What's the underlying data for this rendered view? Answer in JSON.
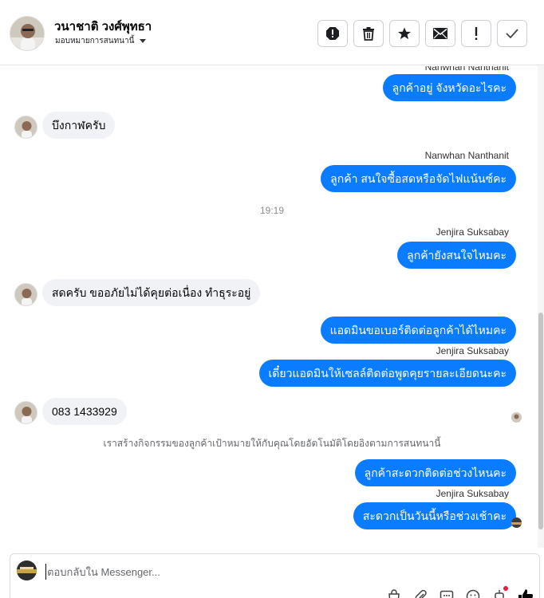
{
  "header": {
    "contact_name": "วนาชาติ วงศ์พุทธา",
    "assign_label": "มอบหมายการสนทนานี้",
    "actions": [
      {
        "name": "spam-alert-icon",
        "label": ""
      },
      {
        "name": "trash-icon",
        "label": ""
      },
      {
        "name": "star-icon",
        "label": ""
      },
      {
        "name": "mail-icon",
        "label": ""
      },
      {
        "name": "exclamation-icon",
        "label": ""
      },
      {
        "name": "check-icon",
        "label": ""
      }
    ]
  },
  "messages": {
    "clipped_sender": "Nanwhan Nanthanit",
    "m1": "ลูกค้าอยู่ จังหวัดอะไรคะ",
    "m2": "บึงกาฬครับ",
    "s3": "Nanwhan Nanthanit",
    "m3": "ลูกค้า สนใจซื้อสดหรือจัดไฟแน้นซ์คะ",
    "time": "19:19",
    "s4": "Jenjira Suksabay",
    "m4": "ลูกค้ายังสนใจไหมคะ",
    "m5": "สดครับ ขออภัยไม่ได้คุยต่อเนื่อง ทำธุระอยู่",
    "m6": "แอดมินขอเบอร์ติดต่อลูกค้าได้ไหมคะ",
    "s7": "Jenjira Suksabay",
    "m7": "เดี๋ยวแอดมินให้เซลล์ติดต่อพูดคุยรายละเอียดนะคะ",
    "m8": "083 1433929",
    "system_note": "เราสร้างกิจกรรมของลูกค้าเป้าหมายให้กับคุณโดยอัตโนมัติโดยอิงตามการสนทนานี้",
    "m9": "ลูกค้าสะดวกติดต่อช่วงไหนคะ",
    "s10": "Jenjira Suksabay",
    "m10": "สะดวกเป็นวันนี้หรือช่วงเช้าคะ"
  },
  "composer": {
    "placeholder": "ตอบกลับใน Messenger...",
    "tools": [
      "shopping-bag-icon",
      "paperclip-icon",
      "saved-reply-icon",
      "emoji-icon",
      "robot-icon",
      "like-icon"
    ]
  },
  "colors": {
    "outgoing_bubble": "#0a7cff",
    "incoming_bubble": "#f0f2f5",
    "notification_dot": "#e41e3f"
  }
}
